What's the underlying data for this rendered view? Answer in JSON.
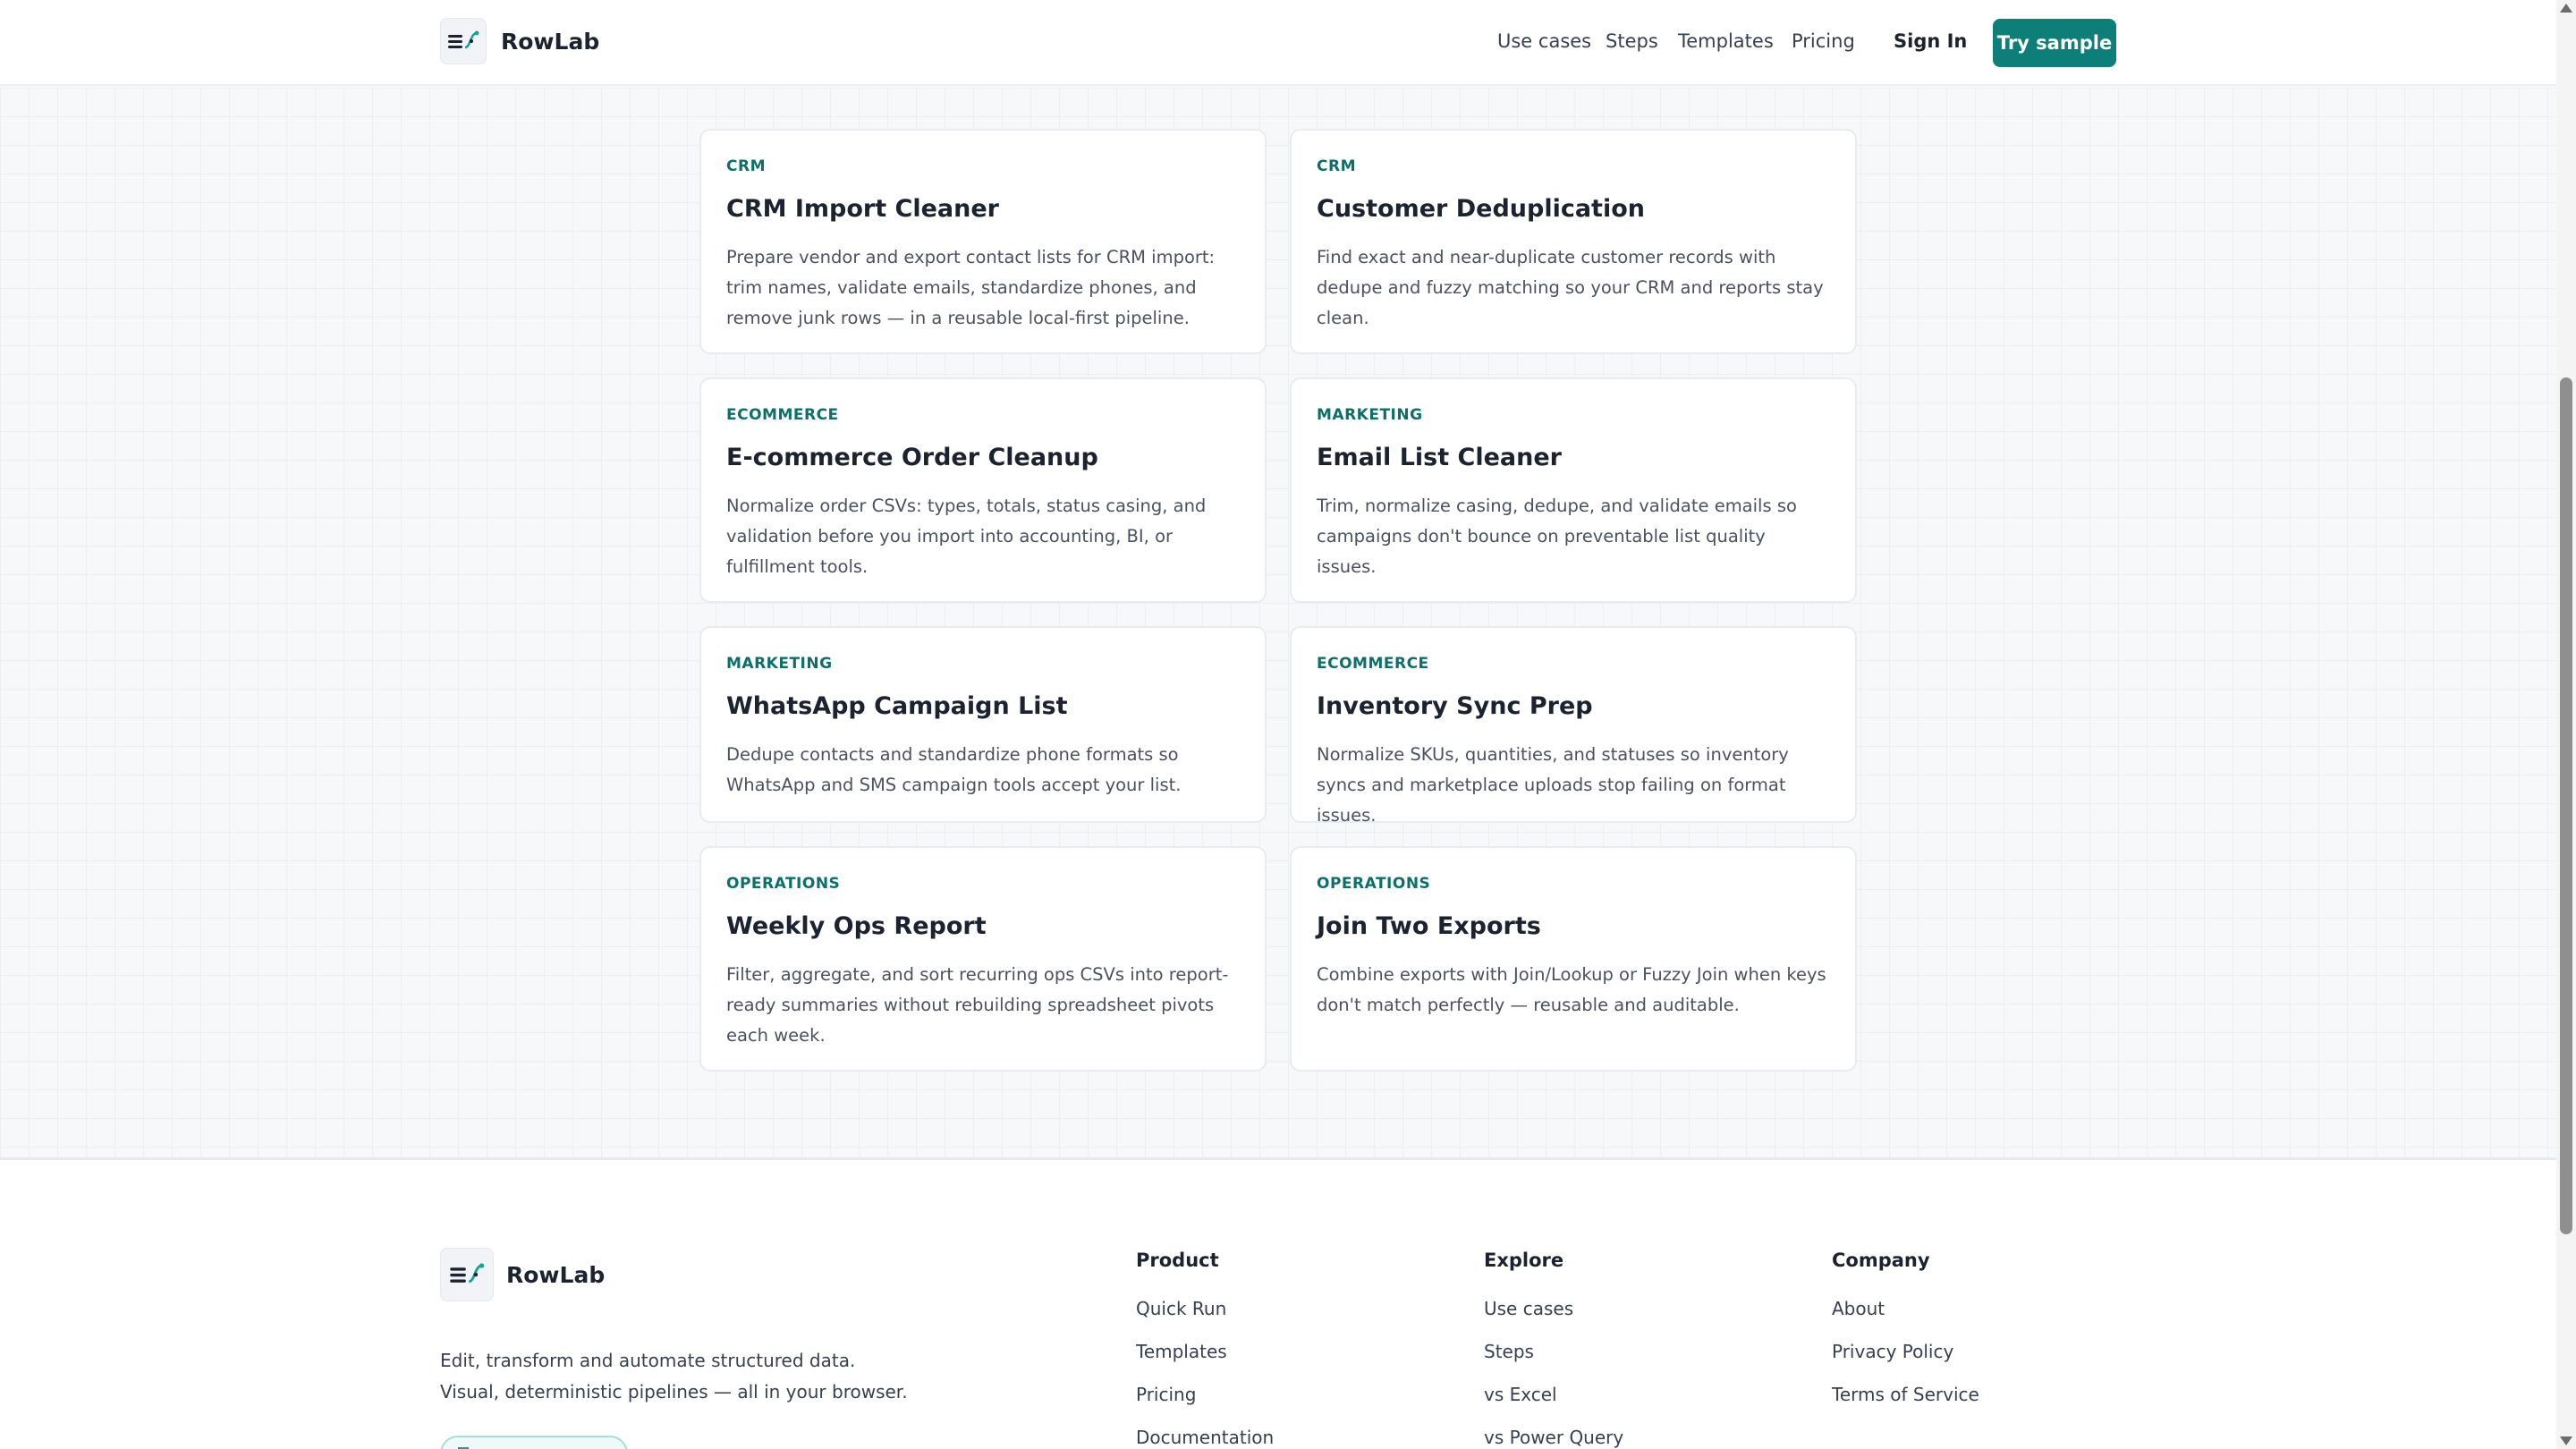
{
  "header": {
    "logo_text": "RowLab",
    "nav": [
      "Use cases",
      "Steps",
      "Templates",
      "Pricing"
    ],
    "signin": "Sign In",
    "try_sample": "Try sample"
  },
  "cards": [
    {
      "tag": "CRM",
      "title": "CRM Import Cleaner",
      "desc": "Prepare vendor and export contact lists for CRM import: trim names, validate emails, standardize phones, and remove junk rows — in a reusable local-first pipeline."
    },
    {
      "tag": "CRM",
      "title": "Customer Deduplication",
      "desc": "Find exact and near-duplicate customer records with dedupe and fuzzy matching so your CRM and reports stay clean."
    },
    {
      "tag": "ECOMMERCE",
      "title": "E-commerce Order Cleanup",
      "desc": "Normalize order CSVs: types, totals, status casing, and validation before you import into accounting, BI, or fulfillment tools."
    },
    {
      "tag": "MARKETING",
      "title": "Email List Cleaner",
      "desc": "Trim, normalize casing, dedupe, and validate emails so campaigns don't bounce on preventable list quality issues."
    },
    {
      "tag": "MARKETING",
      "title": "WhatsApp Campaign List",
      "desc": "Dedupe contacts and standardize phone formats so WhatsApp and SMS campaign tools accept your list."
    },
    {
      "tag": "ECOMMERCE",
      "title": "Inventory Sync Prep",
      "desc": "Normalize SKUs, quantities, and statuses so inventory syncs and marketplace uploads stop failing on format issues."
    },
    {
      "tag": "OPERATIONS",
      "title": "Weekly Ops Report",
      "desc": "Filter, aggregate, and sort recurring ops CSVs into report-ready summaries without rebuilding spreadsheet pivots each week."
    },
    {
      "tag": "OPERATIONS",
      "title": "Join Two Exports",
      "desc": "Combine exports with Join/Lookup or Fuzzy Join when keys don't match perfectly — reusable and auditable."
    }
  ],
  "footer": {
    "logo_text": "RowLab",
    "tagline_1": "Edit, transform and automate structured data.",
    "tagline_2": "Visual, deterministic pipelines — all in your browser.",
    "columns": [
      {
        "title": "Product",
        "links": [
          "Quick Run",
          "Templates",
          "Pricing",
          "Documentation"
        ]
      },
      {
        "title": "Explore",
        "links": [
          "Use cases",
          "Steps",
          "vs Excel",
          "vs Power Query"
        ]
      },
      {
        "title": "Company",
        "links": [
          "About",
          "Privacy Policy",
          "Terms of Service"
        ]
      }
    ]
  },
  "colors": {
    "accent": "#0e7f78",
    "tag_text": "#0e6f6a"
  }
}
